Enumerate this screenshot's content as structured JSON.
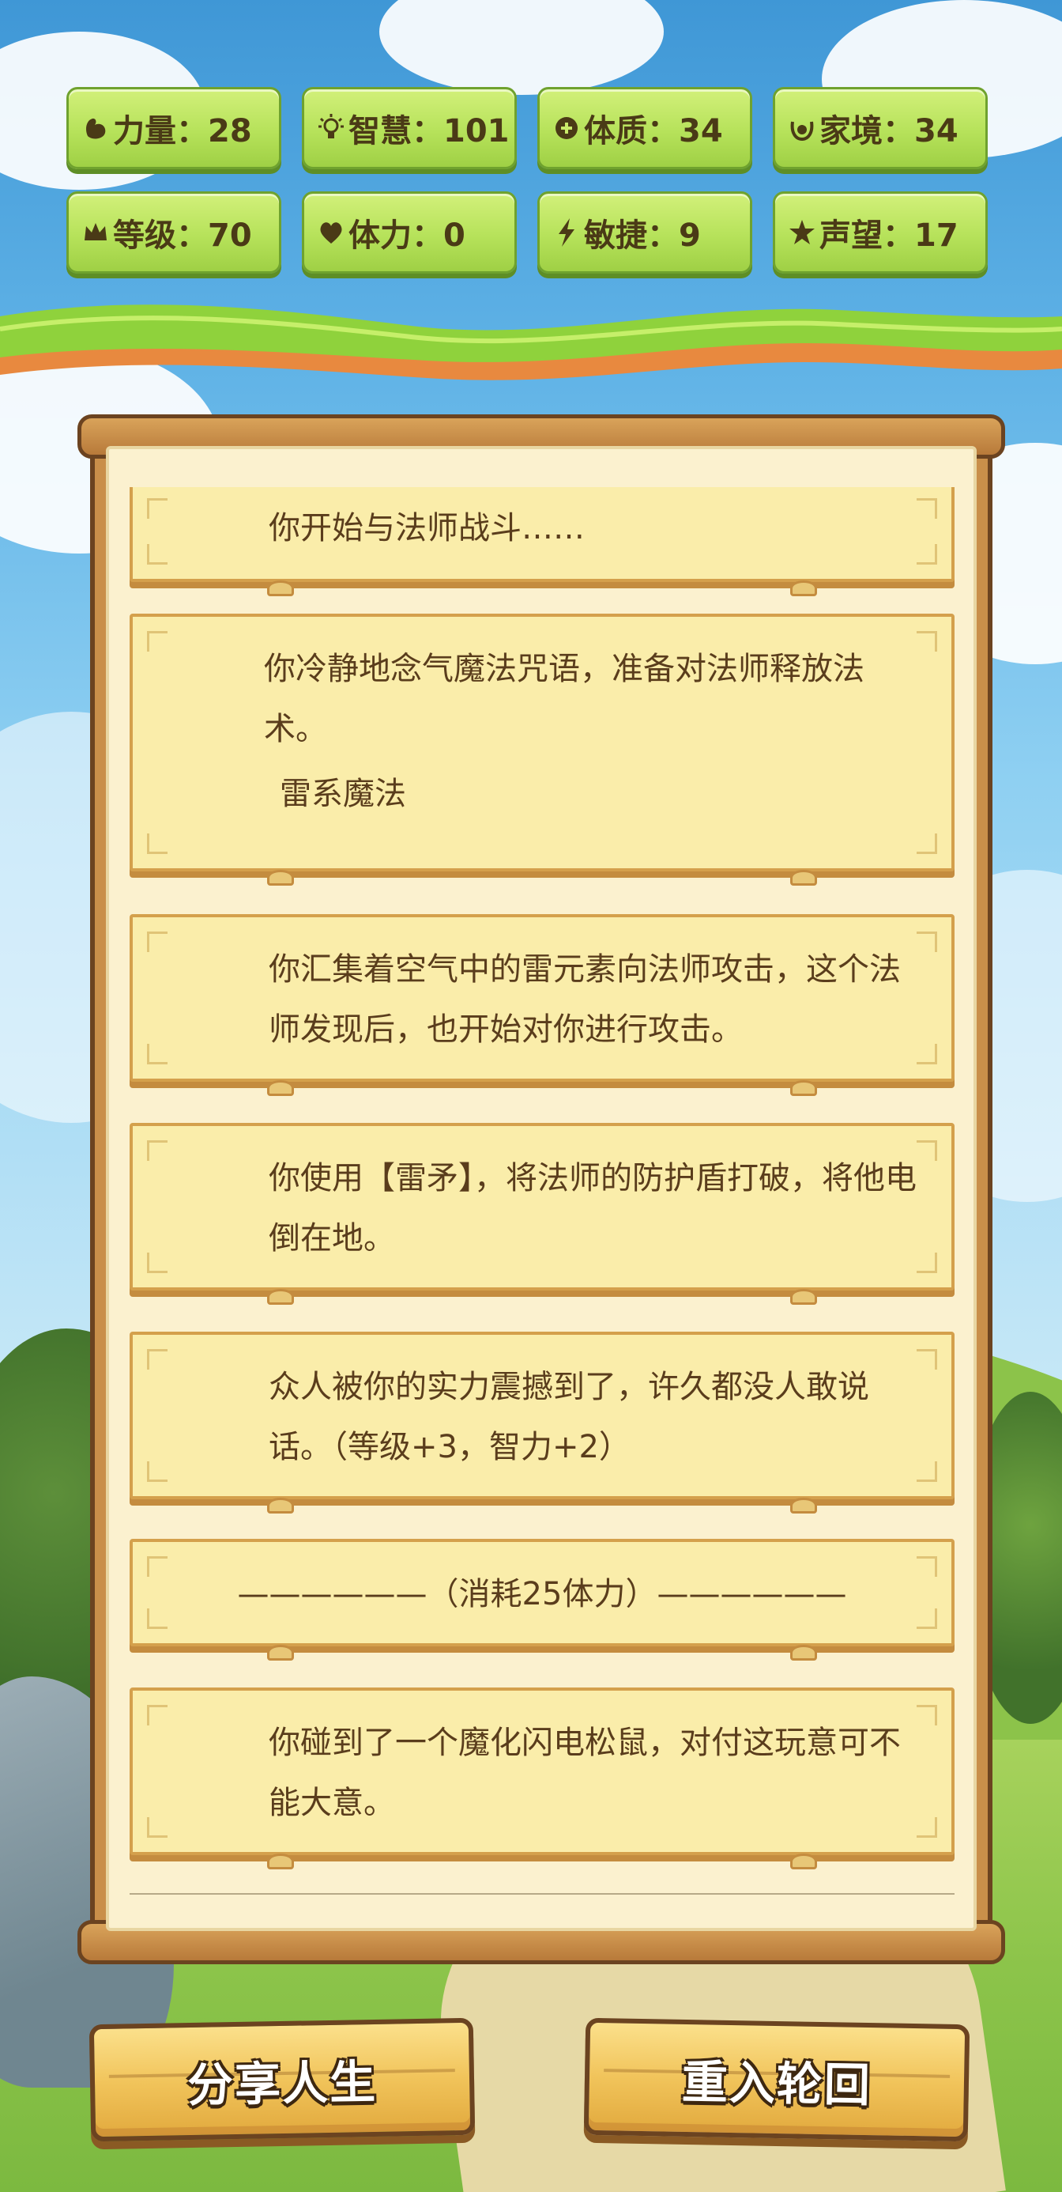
{
  "stats": [
    {
      "icon": "strength-icon",
      "text": "力量：28"
    },
    {
      "icon": "wisdom-icon",
      "text": "智慧：101"
    },
    {
      "icon": "constitution-icon",
      "text": "体质：34"
    },
    {
      "icon": "family-icon",
      "text": "家境：34"
    },
    {
      "icon": "crown-icon",
      "text": "等级：70"
    },
    {
      "icon": "heart-icon",
      "text": "体力：0"
    },
    {
      "icon": "lightning-icon",
      "text": "敏捷：9"
    },
    {
      "icon": "star-icon",
      "text": "声望：17"
    }
  ],
  "log": {
    "entries": [
      {
        "text": "你开始与法师战斗……"
      },
      {
        "text": "你冷静地念气魔法咒语，准备对法师释放法术。",
        "sub": "雷系魔法"
      },
      {
        "text": "你汇集着空气中的雷元素向法师攻击，这个法师发现后，也开始对你进行攻击。"
      },
      {
        "text": "你使用【雷矛】，将法师的防护盾打破，将他电倒在地。"
      },
      {
        "text": "众人被你的实力震撼到了，许久都没人敢说话。（等级+3，智力+2）"
      },
      {
        "text": "——————（消耗25体力）——————"
      },
      {
        "text": "你碰到了一个魔化闪电松鼠，对付这玩意可不能大意。"
      }
    ]
  },
  "buttons": {
    "share_label": "分享人生",
    "reincarnate_label": "重入轮回"
  },
  "colors": {
    "stat_green": "#b6e25a",
    "card_fill": "#faedaa",
    "card_border": "#d4a04c",
    "button_gold": "#f1c45b",
    "outline_brown": "#6b4320"
  }
}
